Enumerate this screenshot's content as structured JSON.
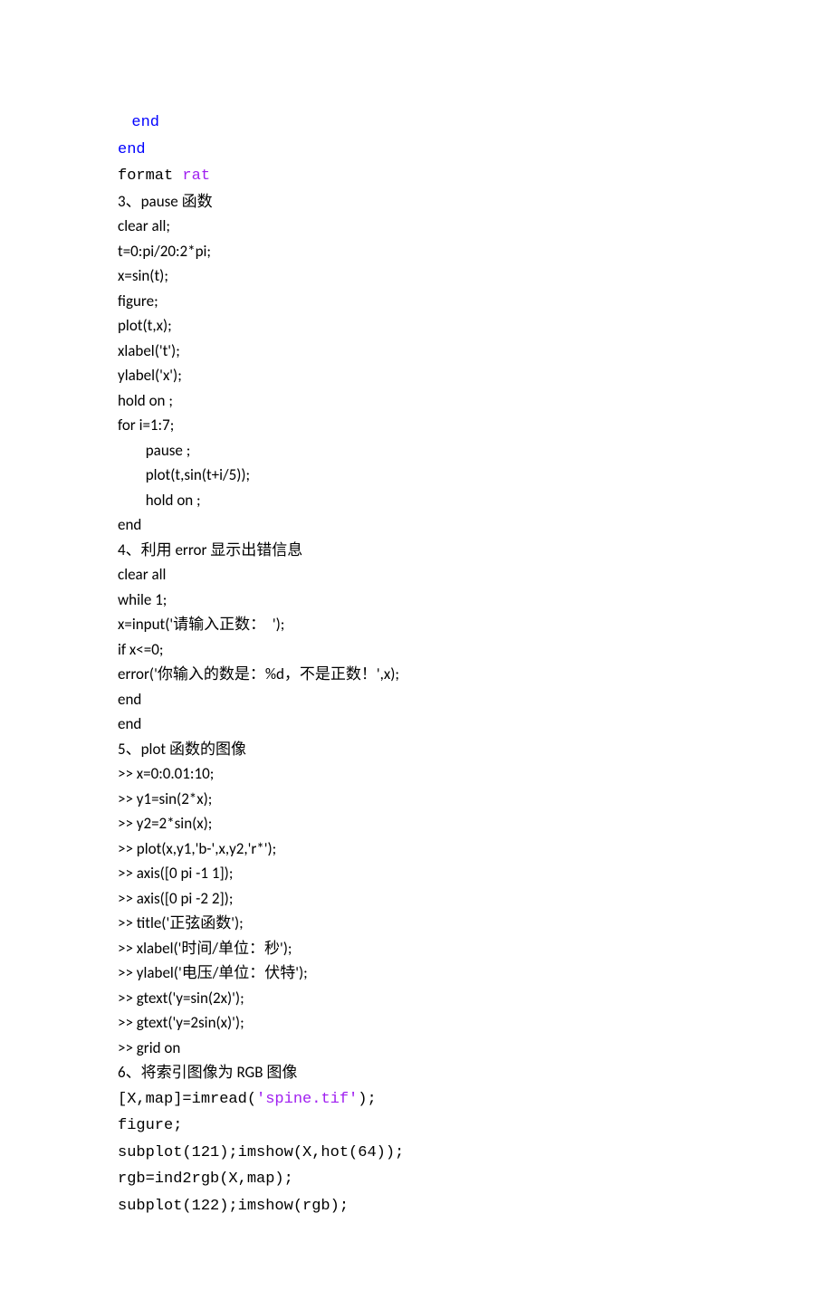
{
  "lines": [
    {
      "indent": "    ",
      "segments": [
        {
          "text": "end",
          "cls": "mono kw-blue"
        }
      ]
    },
    {
      "segments": [
        {
          "text": "end",
          "cls": "mono kw-blue"
        }
      ]
    },
    {
      "segments": [
        {
          "text": "format ",
          "cls": "mono"
        },
        {
          "text": "rat",
          "cls": "mono kw-purple"
        }
      ]
    },
    {
      "segments": [
        {
          "text": "3、pause 函数"
        }
      ]
    },
    {
      "segments": [
        {
          "text": "clear all;"
        }
      ]
    },
    {
      "segments": [
        {
          "text": "t=0:pi/20:2*pi;"
        }
      ]
    },
    {
      "segments": [
        {
          "text": "x=sin(t);"
        }
      ]
    },
    {
      "segments": [
        {
          "text": "figure;"
        }
      ]
    },
    {
      "segments": [
        {
          "text": "plot(t,x);"
        }
      ]
    },
    {
      "segments": [
        {
          "text": "xlabel('t');"
        }
      ]
    },
    {
      "segments": [
        {
          "text": "ylabel('x');"
        }
      ]
    },
    {
      "segments": [
        {
          "text": "hold on ;"
        }
      ]
    },
    {
      "segments": [
        {
          "text": "for i=1:7;"
        }
      ]
    },
    {
      "segments": [
        {
          "text": "        pause ;"
        }
      ]
    },
    {
      "segments": [
        {
          "text": "        plot(t,sin(t+i/5));"
        }
      ]
    },
    {
      "segments": [
        {
          "text": "        hold on ;"
        }
      ]
    },
    {
      "segments": [
        {
          "text": "end"
        }
      ]
    },
    {
      "segments": [
        {
          "text": "4、利用 error 显示出错信息"
        }
      ]
    },
    {
      "segments": [
        {
          "text": "clear all"
        }
      ]
    },
    {
      "segments": [
        {
          "text": "while 1;"
        }
      ]
    },
    {
      "segments": [
        {
          "text": "x=input('请输入正数：  ');"
        }
      ]
    },
    {
      "segments": [
        {
          "text": "if x<=0;"
        }
      ]
    },
    {
      "segments": [
        {
          "text": "error('你输入的数是：%d，不是正数！',x);"
        }
      ]
    },
    {
      "segments": [
        {
          "text": "end"
        }
      ]
    },
    {
      "segments": [
        {
          "text": "end"
        }
      ]
    },
    {
      "segments": [
        {
          "text": "5、plot 函数的图像"
        }
      ]
    },
    {
      "segments": [
        {
          "text": ">> x=0:0.01:10;"
        }
      ]
    },
    {
      "segments": [
        {
          "text": ">> y1=sin(2*x);"
        }
      ]
    },
    {
      "segments": [
        {
          "text": ">> y2=2*sin(x);"
        }
      ]
    },
    {
      "segments": [
        {
          "text": ">> plot(x,y1,'b-',x,y2,'r*');"
        }
      ]
    },
    {
      "segments": [
        {
          "text": ">> axis([0 pi -1 1]);"
        }
      ]
    },
    {
      "segments": [
        {
          "text": ">> axis([0 pi -2 2]);"
        }
      ]
    },
    {
      "segments": [
        {
          "text": ">> title('正弦函数');"
        }
      ]
    },
    {
      "segments": [
        {
          "text": ">> xlabel('时间/单位：秒');"
        }
      ]
    },
    {
      "segments": [
        {
          "text": ">> ylabel('电压/单位：伏特');"
        }
      ]
    },
    {
      "segments": [
        {
          "text": ">> gtext('y=sin(2x)');"
        }
      ]
    },
    {
      "segments": [
        {
          "text": ">> gtext('y=2sin(x)');"
        }
      ]
    },
    {
      "segments": [
        {
          "text": ">> grid on"
        }
      ]
    },
    {
      "segments": [
        {
          "text": "6、将索引图像为 RGB 图像"
        }
      ]
    },
    {
      "segments": [
        {
          "text": "[X,map]=imread(",
          "cls": "mono"
        },
        {
          "text": "'spine.tif'",
          "cls": "mono str-purple"
        },
        {
          "text": ");",
          "cls": "mono"
        }
      ]
    },
    {
      "segments": [
        {
          "text": "figure;",
          "cls": "mono"
        }
      ]
    },
    {
      "segments": [
        {
          "text": "subplot(121);imshow(X,hot(64));",
          "cls": "mono"
        }
      ]
    },
    {
      "segments": [
        {
          "text": "rgb=ind2rgb(X,map);",
          "cls": "mono"
        }
      ]
    },
    {
      "segments": [
        {
          "text": "subplot(122);imshow(rgb);",
          "cls": "mono"
        }
      ]
    }
  ]
}
